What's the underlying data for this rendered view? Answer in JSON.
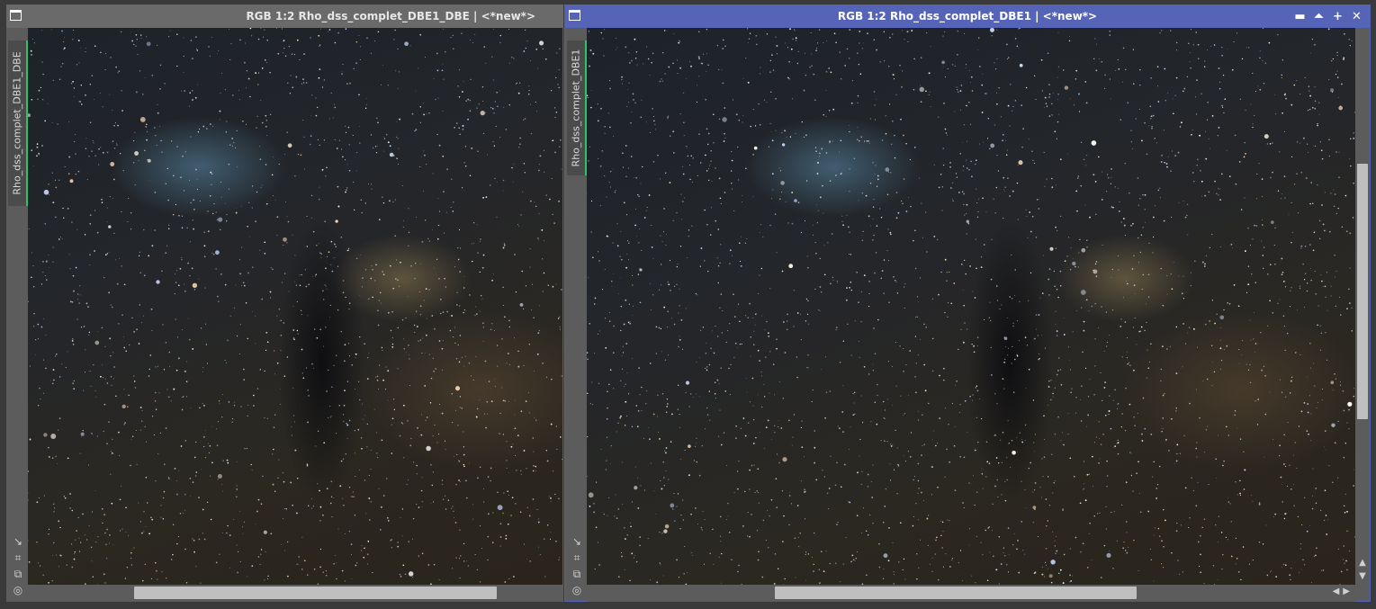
{
  "windows": [
    {
      "title": "RGB 1:2 Rho_dss_complet_DBE1_DBE | <*new*>",
      "side_tab": "Rho_dss_complet_DBE1_DBE",
      "active": false
    },
    {
      "title": "RGB 1:2 Rho_dss_complet_DBE1 | <*new*>",
      "side_tab": "Rho_dss_complet_DBE1",
      "active": true,
      "buttons": {
        "minimize": "▬",
        "shade": "⏶",
        "maximize": "+",
        "close": "✕"
      }
    }
  ],
  "tool_icons": [
    "↘",
    "⌗",
    "⧉",
    "◎"
  ],
  "scroll_arrows": {
    "up": "▲",
    "down": "▼",
    "left": "◀",
    "right": "▶"
  },
  "colors": {
    "active_title": "#5564b6",
    "inactive_title": "#6a6a6a",
    "side_tab_accent": "#2ec36a"
  }
}
